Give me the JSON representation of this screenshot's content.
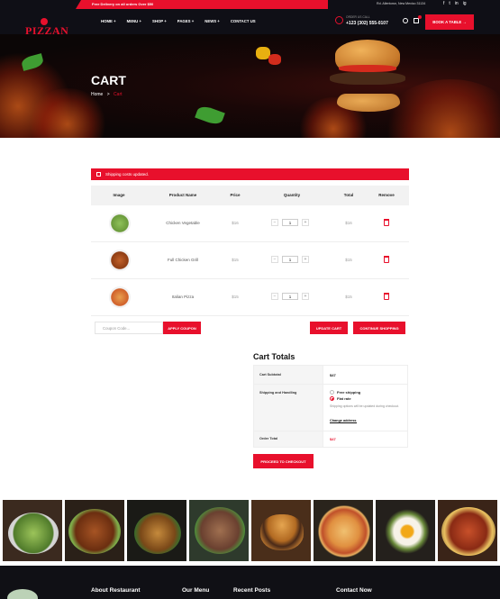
{
  "topbar": {
    "promo": "Free Delivery on all orders Over $50",
    "address": "Rd. Allentown, New Mexico 31134",
    "socials": [
      "f",
      "t",
      "in",
      "ig"
    ]
  },
  "header": {
    "logo": "PIZZAN",
    "logo_tagline": "",
    "nav": [
      {
        "label": "HOME +"
      },
      {
        "label": "MENU +"
      },
      {
        "label": "SHOP +"
      },
      {
        "label": "PAGES +"
      },
      {
        "label": "NEWS +"
      },
      {
        "label": "CONTACT US"
      }
    ],
    "call_label": "ORDER US CALL",
    "phone": "+123 (302) 555-0107",
    "book_label": "BOOK A TABLE →"
  },
  "hero": {
    "title": "CART",
    "breadcrumb_home": "Home",
    "breadcrumb_sep": ">",
    "breadcrumb_current": "Cart"
  },
  "alert": {
    "message": "Shipping costs updated."
  },
  "cart": {
    "columns": [
      "Image",
      "Product Name",
      "Price",
      "Quantity",
      "Total",
      "Remove"
    ],
    "rows": [
      {
        "name": "Chicken Vegetable",
        "price": "$16",
        "qty": "1",
        "total": "$16",
        "color": "#7fae4a"
      },
      {
        "name": "Full Chicken Grill",
        "price": "$15",
        "qty": "1",
        "total": "$15",
        "color": "#b5541d"
      },
      {
        "name": "Italian Pizza",
        "price": "$15",
        "qty": "1",
        "total": "$15",
        "color": "#e07a3a"
      }
    ],
    "minus": "−",
    "plus": "+",
    "coupon_placeholder": "Coupon Code...",
    "apply_label": "APPLY COUPON",
    "update_label": "UPDATE CART",
    "continue_label": "CONTINUE SHOPPING"
  },
  "totals": {
    "title": "Cart Totals",
    "subtotal_label": "Cart Subtotal",
    "subtotal_value": "$47",
    "shipping_label": "Shipping and Handling",
    "free_shipping": "Free shipping",
    "flat_rate": "Flat rate",
    "shipping_note": "Shipping options will be updated during checkout.",
    "change_address": "Change address",
    "order_total_label": "Order Total",
    "order_total_value": "$47",
    "checkout_label": "PROCEED TO CHECKOUT"
  },
  "footer": {
    "headings": [
      "About Restaurant",
      "Our Menu",
      "Recent Posts",
      "Contact Now"
    ]
  },
  "colors": {
    "accent": "#e8102c",
    "dark": "#0f0f16"
  }
}
